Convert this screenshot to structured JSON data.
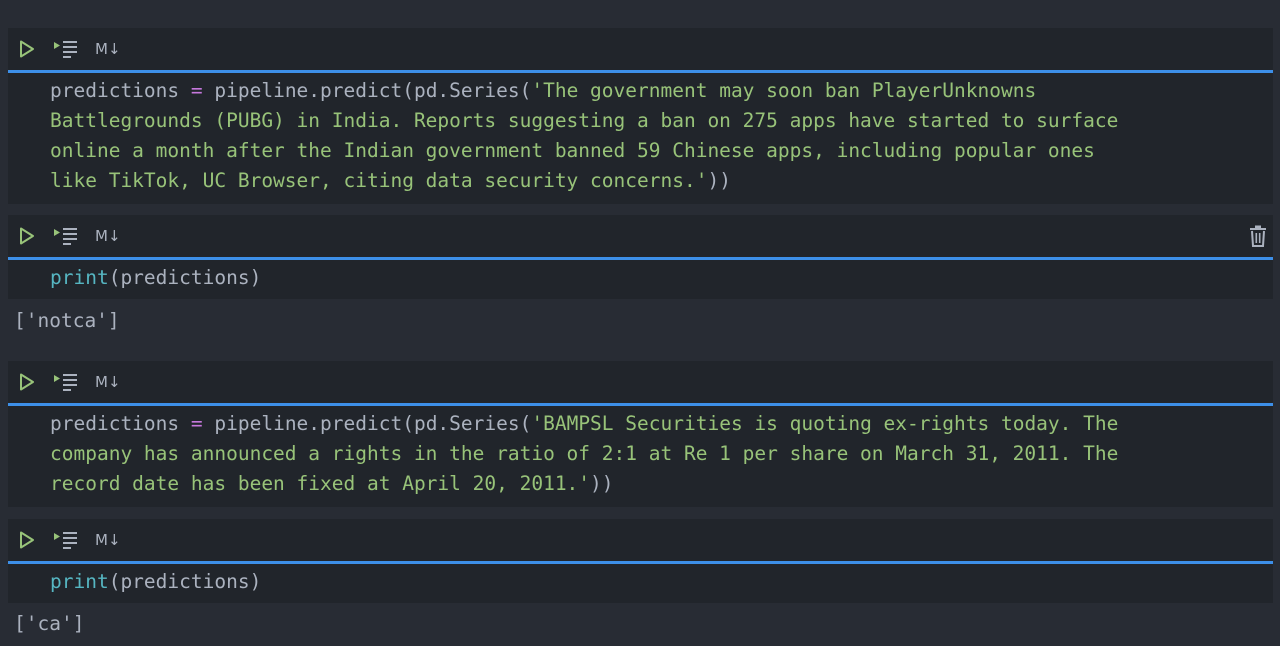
{
  "toolbar": {
    "markdown_label": "M↓"
  },
  "cells": [
    {
      "lines": [
        {
          "var": "predictions",
          "op": " = ",
          "call": "pipeline.predict(pd.Series(",
          "str": "'The government may soon ban PlayerUnknowns"
        },
        {
          "str": "Battlegrounds (PUBG) in India. Reports suggesting a ban on 275 apps have started to surface"
        },
        {
          "str": "online a month after the Indian government banned 59 Chinese apps, including popular ones"
        },
        {
          "str": "like TikTok, UC Browser, citing data security concerns.'",
          "tail": "))"
        }
      ]
    },
    {
      "fn": "print",
      "args": "(predictions)",
      "output": "['notca']"
    },
    {
      "lines": [
        {
          "var": "predictions",
          "op": " = ",
          "call": "pipeline.predict(pd.Series(",
          "str": "'BAMPSL Securities is quoting ex-rights today. The"
        },
        {
          "str": "company has announced a rights in the ratio of 2:1 at Re 1 per share on March 31, 2011. The"
        },
        {
          "str": "record date has been fixed at April 20, 2011.'",
          "tail": "))"
        }
      ]
    },
    {
      "fn": "print",
      "args": "(predictions)",
      "output": "['ca']"
    }
  ],
  "colors": {
    "background": "#282c34",
    "cell_background": "#21252b",
    "active_divider": "#3d8fe8",
    "run_icon": "#98c379",
    "string": "#98c379",
    "builtin": "#56b6c2",
    "operator": "#c678dd",
    "text": "#abb2bf"
  },
  "icons": [
    "run-cell-icon",
    "run-below-icon",
    "markdown-icon",
    "trash-icon"
  ]
}
